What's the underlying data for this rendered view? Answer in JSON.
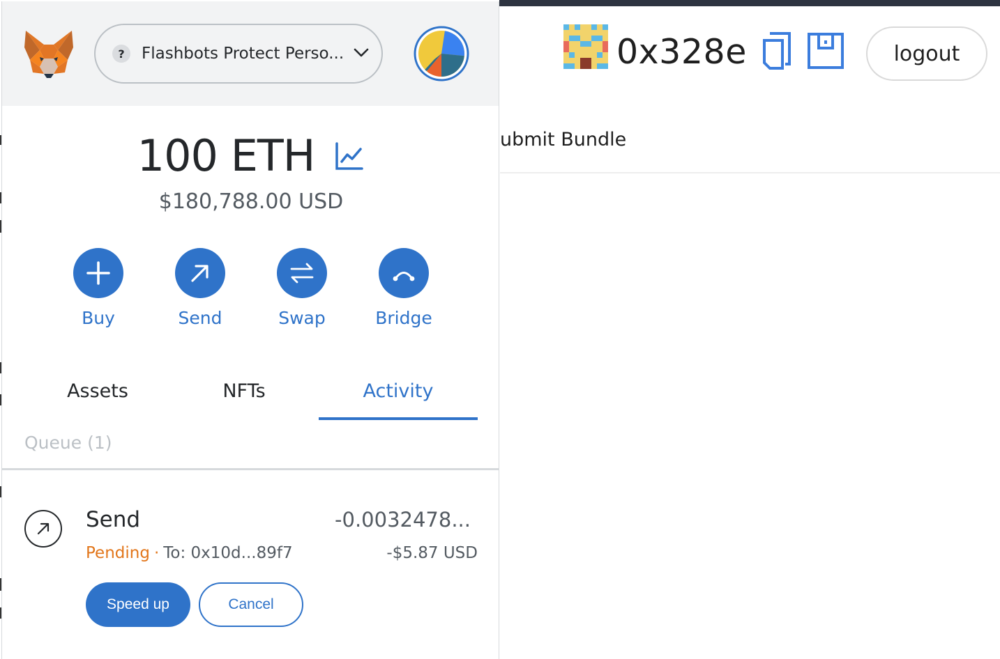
{
  "background_page": {
    "address": "0x328e",
    "logout_label": "logout",
    "nav_partial_text": "ubmit Bundle"
  },
  "wallet": {
    "network_label": "Flashbots Protect Perso...",
    "network_help_glyph": "?",
    "balance_eth": "100 ETH",
    "balance_usd": "$180,788.00 USD",
    "actions": [
      {
        "label": "Buy",
        "icon": "plus-icon"
      },
      {
        "label": "Send",
        "icon": "arrow-up-right-icon"
      },
      {
        "label": "Swap",
        "icon": "swap-arrows-icon"
      },
      {
        "label": "Bridge",
        "icon": "bridge-icon"
      }
    ],
    "tabs": [
      {
        "label": "Assets",
        "active": false
      },
      {
        "label": "NFTs",
        "active": false
      },
      {
        "label": "Activity",
        "active": true
      }
    ],
    "queue_label": "Queue (1)",
    "transaction": {
      "title": "Send",
      "status": "Pending",
      "separator": "·",
      "to": "To: 0x10d...89f7",
      "amount": "-0.0032478...",
      "amount_usd": "-$5.87 USD",
      "speed_up_label": "Speed up",
      "cancel_label": "Cancel"
    }
  },
  "colors": {
    "accent": "#2f73c9",
    "pending": "#e2761b",
    "header_bg": "#f2f3f4"
  }
}
